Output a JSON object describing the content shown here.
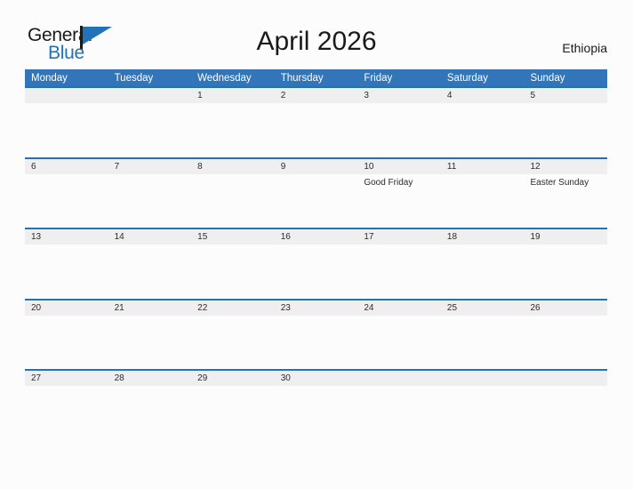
{
  "brand": {
    "name_part1": "General",
    "name_part2": "Blue",
    "flag_icon": "flag-triangle-icon",
    "accent_color": "#2272b8"
  },
  "header": {
    "title": "April 2026",
    "country": "Ethiopia"
  },
  "colors": {
    "header_blue": "#3275b8",
    "divider_blue": "#2272b8",
    "day_band_gray": "#efefef",
    "page_background": "#fcfcfc",
    "text": "#1a1a1a"
  },
  "calendar": {
    "weekdays": [
      "Monday",
      "Tuesday",
      "Wednesday",
      "Thursday",
      "Friday",
      "Saturday",
      "Sunday"
    ],
    "weeks": [
      {
        "days": [
          {
            "num": "",
            "event": ""
          },
          {
            "num": "",
            "event": ""
          },
          {
            "num": "1",
            "event": ""
          },
          {
            "num": "2",
            "event": ""
          },
          {
            "num": "3",
            "event": ""
          },
          {
            "num": "4",
            "event": ""
          },
          {
            "num": "5",
            "event": ""
          }
        ]
      },
      {
        "days": [
          {
            "num": "6",
            "event": ""
          },
          {
            "num": "7",
            "event": ""
          },
          {
            "num": "8",
            "event": ""
          },
          {
            "num": "9",
            "event": ""
          },
          {
            "num": "10",
            "event": "Good Friday"
          },
          {
            "num": "11",
            "event": ""
          },
          {
            "num": "12",
            "event": "Easter Sunday"
          }
        ]
      },
      {
        "days": [
          {
            "num": "13",
            "event": ""
          },
          {
            "num": "14",
            "event": ""
          },
          {
            "num": "15",
            "event": ""
          },
          {
            "num": "16",
            "event": ""
          },
          {
            "num": "17",
            "event": ""
          },
          {
            "num": "18",
            "event": ""
          },
          {
            "num": "19",
            "event": ""
          }
        ]
      },
      {
        "days": [
          {
            "num": "20",
            "event": ""
          },
          {
            "num": "21",
            "event": ""
          },
          {
            "num": "22",
            "event": ""
          },
          {
            "num": "23",
            "event": ""
          },
          {
            "num": "24",
            "event": ""
          },
          {
            "num": "25",
            "event": ""
          },
          {
            "num": "26",
            "event": ""
          }
        ]
      },
      {
        "days": [
          {
            "num": "27",
            "event": ""
          },
          {
            "num": "28",
            "event": ""
          },
          {
            "num": "29",
            "event": ""
          },
          {
            "num": "30",
            "event": ""
          },
          {
            "num": "",
            "event": ""
          },
          {
            "num": "",
            "event": ""
          },
          {
            "num": "",
            "event": ""
          }
        ]
      }
    ]
  }
}
